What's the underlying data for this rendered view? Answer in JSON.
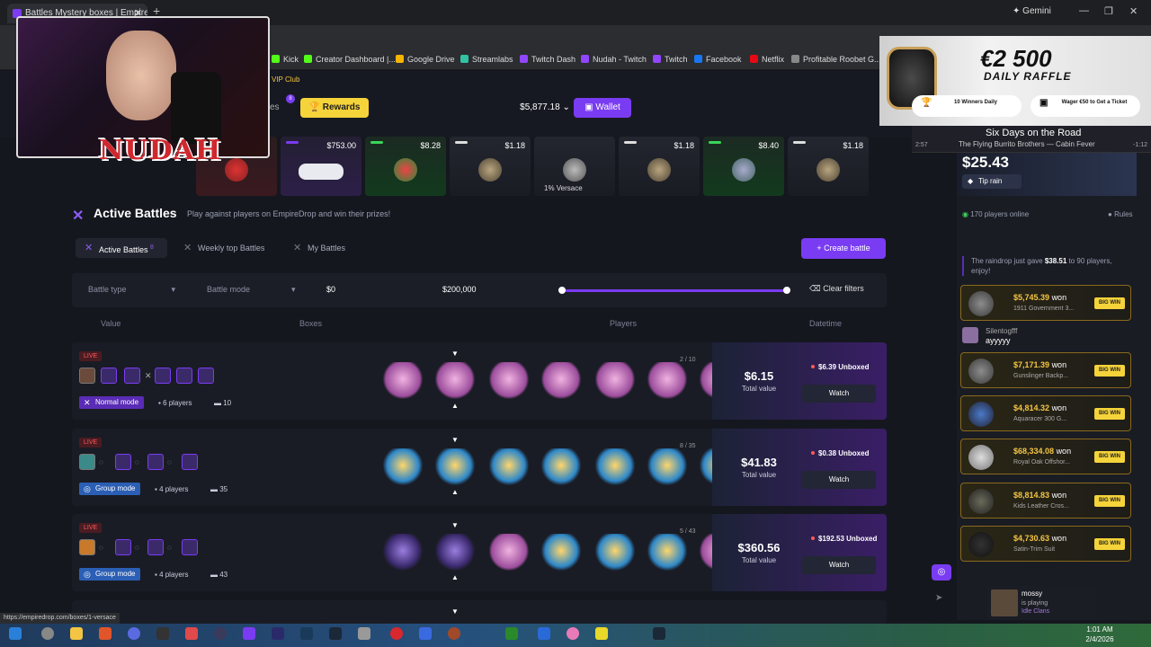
{
  "browser": {
    "tab_title": "Battles Mystery boxes | Empire",
    "gemini": "Gemini",
    "bookmarks": [
      "Kick",
      "Creator Dashboard |...",
      "Google Drive",
      "Streamlabs",
      "Twitch Dash",
      "Nudah - Twitch",
      "Twitch",
      "Facebook",
      "Netflix",
      "Profitable Roobet G..."
    ],
    "status_url": "https://empiredrop.com/boxes/1-versace"
  },
  "header": {
    "vip_club": "VIP Club",
    "peek_text": "es",
    "notif_count": "8",
    "rewards_label": "Rewards",
    "balance": "$5,877.18",
    "wallet_label": "Wallet"
  },
  "drops": [
    {
      "price": "$753.00"
    },
    {
      "price": "$8.28"
    },
    {
      "price": "$1.18"
    },
    {
      "price": ""
    },
    {
      "price": "$1.18"
    },
    {
      "price": "$8.40"
    },
    {
      "price": "$1.18"
    }
  ],
  "drop_hover_label": "1% Versace",
  "battles_section": {
    "title": "Active Battles",
    "subtitle": "Play against players on EmpireDrop and win their prizes!",
    "tabs": [
      {
        "label": "Active Battles",
        "count": "8"
      },
      {
        "label": "Weekly top Battles"
      },
      {
        "label": "My Battles"
      }
    ],
    "create_label": "Create battle"
  },
  "filters": {
    "battle_type": "Battle type",
    "battle_mode": "Battle mode",
    "min_value": "$0",
    "max_value": "$200,000",
    "clear_label": "Clear filters"
  },
  "columns": [
    "Value",
    "Boxes",
    "Players",
    "Datetime"
  ],
  "battles": [
    {
      "live": "LIVE",
      "mode": "Normal mode",
      "players": "6 players",
      "boxes": "10",
      "round": "2 / 10",
      "total": "$6.15",
      "total_label": "Total value",
      "unboxed": "$6.39 Unboxed",
      "watch": "Watch"
    },
    {
      "live": "LIVE",
      "mode": "Group mode",
      "players": "4 players",
      "boxes": "35",
      "round": "8 / 35",
      "total": "$41.83",
      "total_label": "Total value",
      "unboxed": "$0.38 Unboxed",
      "watch": "Watch"
    },
    {
      "live": "LIVE",
      "mode": "Group mode",
      "players": "4 players",
      "boxes": "43",
      "round": "5 / 43",
      "total": "$360.56",
      "total_label": "Total value",
      "unboxed": "$192.53 Unboxed",
      "watch": "Watch"
    }
  ],
  "sidebar": {
    "tip_amount": "$25.43",
    "tip_label": "Tip rain",
    "online": "170 players online",
    "rules": "Rules",
    "rain_msg_pre": "The raindrop just gave ",
    "rain_amount": "$38.51",
    "rain_msg_post": " to 90 players, enjoy!",
    "chat_user": "Silentogfff",
    "chat_message": "ayyyyy",
    "wins": [
      {
        "amount": "$5,745.39",
        "won": "won",
        "item": "1911 Government 3...",
        "badge": "BIG WIN"
      },
      {
        "amount": "$7,171.39",
        "won": "won",
        "item": "Gunslinger Backp...",
        "badge": "BIG WIN"
      },
      {
        "amount": "$4,814.32",
        "won": "won",
        "item": "Aquaracer 300 G...",
        "badge": "BIG WIN"
      },
      {
        "amount": "$68,334.08",
        "won": "won",
        "item": "Royal Oak Offshor...",
        "badge": "BIG WIN"
      },
      {
        "amount": "$8,814.83",
        "won": "won",
        "item": "Kids Leather Cros...",
        "badge": "BIG WIN"
      },
      {
        "amount": "$4,730.63",
        "won": "won",
        "item": "Satin-Trim Suit",
        "badge": "BIG WIN"
      }
    ]
  },
  "overlay": {
    "streamer_logo": "NUDAH",
    "raffle_amount": "€2 500",
    "raffle_title": "DAILY RAFFLE",
    "raffle_chip1": "10 Winners Daily",
    "raffle_chip2": "Wager €50 to Get a Ticket",
    "song_title": "Six Days on the Road",
    "song_artist": "The Flying Burrito Brothers — Cabin Fever",
    "song_elapsed": "2:57",
    "song_remaining": "-1:12",
    "now_playing_name": "mossy",
    "now_playing_status": "is playing",
    "now_playing_game": "Idle Clans"
  },
  "taskbar": {
    "time": "1:01 AM",
    "date": "2/4/2026"
  }
}
